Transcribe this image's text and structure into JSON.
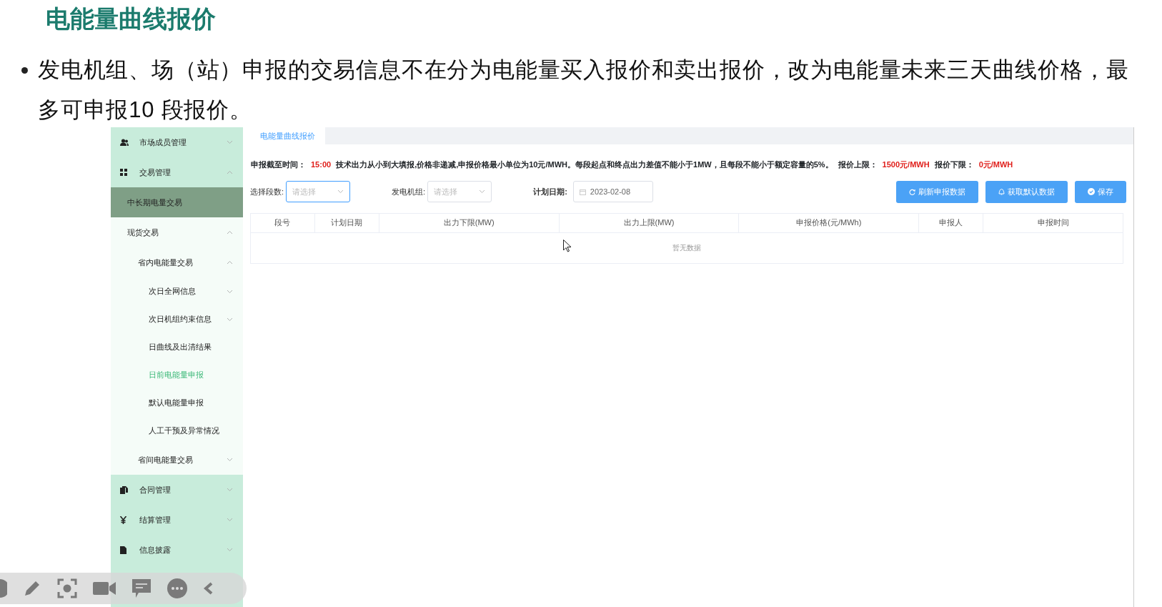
{
  "slide": {
    "title": "电能量曲线报价",
    "bullets": [
      "发电机组、场（站）申报的交易信息不在分为电能量买入报价和卖出报价，改为电能量未来三天曲线价格，最多可申报10 段报价。"
    ]
  },
  "app": {
    "sidebar": {
      "items": [
        {
          "label": "市场成员管理",
          "expanded": false,
          "selected": false
        },
        {
          "label": "交易管理",
          "expanded": true,
          "selected": false,
          "children": [
            {
              "label": "中长期电量交易",
              "selected": false,
              "hovered": true
            },
            {
              "label": "现货交易",
              "expanded": true,
              "selected": false,
              "children": [
                {
                  "label": "省内电能量交易",
                  "expanded": true,
                  "selected": false,
                  "children": [
                    {
                      "label": "次日全网信息",
                      "expanded": false,
                      "selected": false
                    },
                    {
                      "label": "次日机组约束信息",
                      "expanded": false,
                      "selected": false
                    },
                    {
                      "label": "日曲线及出清结果",
                      "selected": false
                    },
                    {
                      "label": "日前电能量申报",
                      "selected": true
                    },
                    {
                      "label": "默认电能量申报",
                      "selected": false
                    },
                    {
                      "label": "人工干预及异常情况",
                      "selected": false
                    }
                  ]
                },
                {
                  "label": "省间电能量交易",
                  "expanded": false,
                  "selected": false
                }
              ]
            }
          ]
        },
        {
          "label": "合同管理",
          "expanded": false,
          "selected": false
        },
        {
          "label": "结算管理",
          "expanded": false,
          "selected": false
        },
        {
          "label": "信息披露",
          "expanded": false,
          "selected": false
        }
      ]
    },
    "tabs": [
      {
        "label": "电能量曲线报价",
        "selected": true
      }
    ],
    "notice": [
      {
        "text": "申报截至时间：",
        "kind": "label"
      },
      {
        "text": "15:00",
        "kind": "value"
      },
      {
        "text": "技术出力从小到大填报,价格非递减,申报价格最小单位为10元/MWH。每段起点和终点出力差值不能小于1MW，且每段不能小于额定容量的5%。",
        "kind": "label"
      },
      {
        "text": "报价上限：",
        "kind": "label"
      },
      {
        "text": "1500元/MWH",
        "kind": "value"
      },
      {
        "text": "报价下限：",
        "kind": "label"
      },
      {
        "text": "0元/MWH",
        "kind": "value"
      }
    ],
    "form": {
      "fields": [
        {
          "label": "选择段数:",
          "kind": "select",
          "placeholder": "请选择",
          "focused": true,
          "strong": false
        },
        {
          "label": "发电机组:",
          "kind": "select",
          "placeholder": "请选择",
          "focused": false,
          "strong": false
        },
        {
          "label": "计划日期:",
          "kind": "date",
          "value": "2023-02-08",
          "focused": false,
          "strong": true
        }
      ]
    },
    "buttons": [
      {
        "label": "刷新申报数据"
      },
      {
        "label": "获取默认数据"
      },
      {
        "label": "保存"
      }
    ],
    "table": {
      "columns": [
        "段号",
        "计划日期",
        "出力下限(MW)",
        "出力上限(MW)",
        "申报价格(元/MWh)",
        "申报人",
        "申报时间"
      ],
      "empty_text": "暂无数据"
    }
  }
}
